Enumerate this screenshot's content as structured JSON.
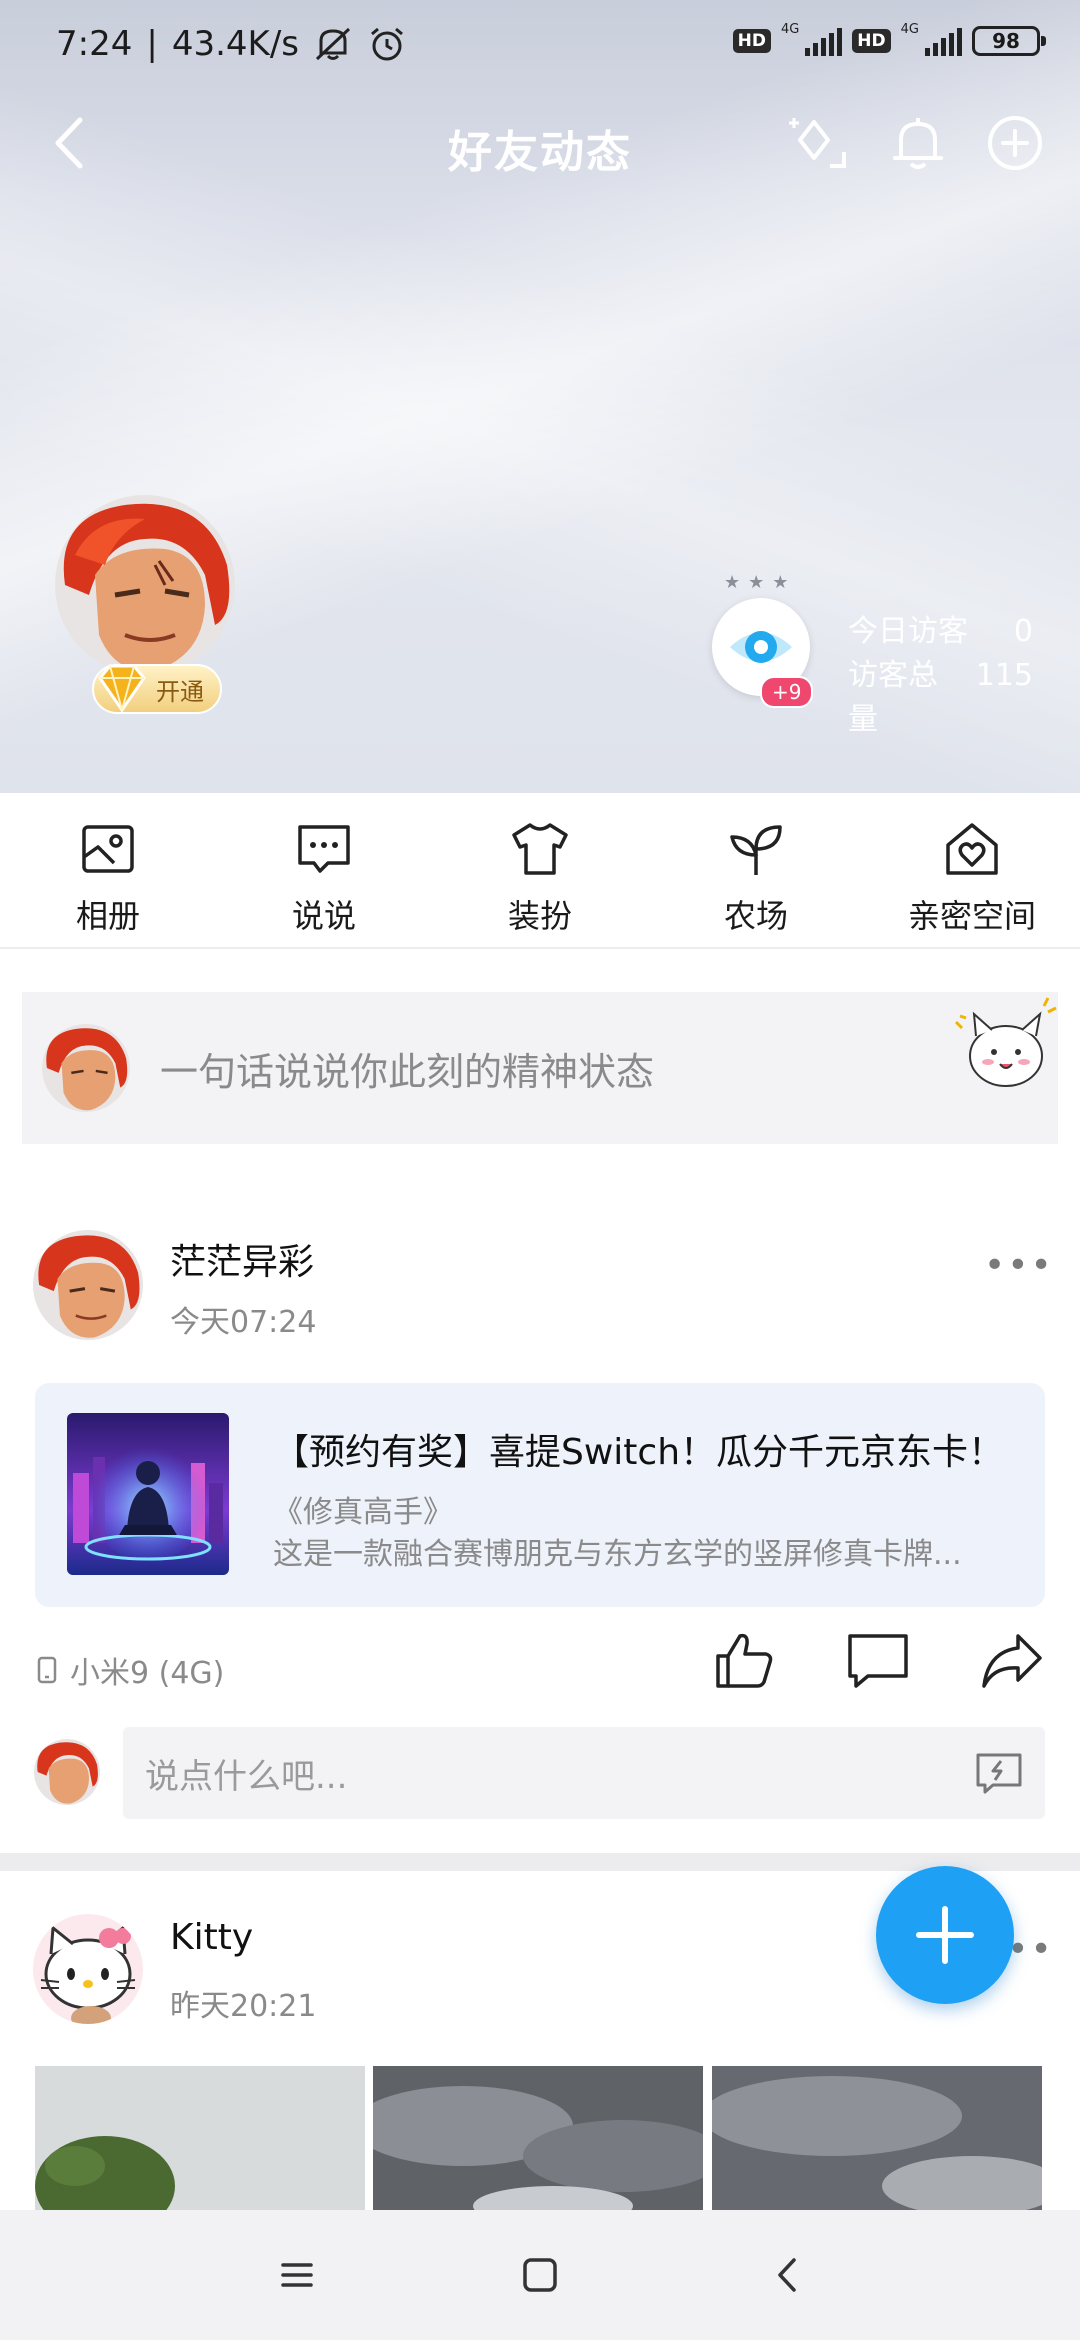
{
  "status_bar": {
    "time": "7:24",
    "separator": "|",
    "net_speed": "43.4K/s",
    "sim1_badge": "HD",
    "sim1_type": "4G",
    "sim2_badge": "HD",
    "sim2_type": "4G",
    "battery": "98",
    "icons": [
      "mute-icon",
      "alarm-icon"
    ]
  },
  "header": {
    "title": "好友动态",
    "icons": [
      "back-icon",
      "decorate-icon",
      "bell-icon",
      "add-circle-icon"
    ]
  },
  "profile": {
    "vip_label": "开通"
  },
  "visitors": {
    "badge": "+9",
    "today_label": "今日访客",
    "today_value": "0",
    "total_label": "访客总量",
    "total_value": "115"
  },
  "quick_menu": [
    {
      "label": "相册",
      "icon": "album-icon"
    },
    {
      "label": "说说",
      "icon": "chat-icon"
    },
    {
      "label": "装扮",
      "icon": "tshirt-icon"
    },
    {
      "label": "农场",
      "icon": "sprout-icon"
    },
    {
      "label": "亲密空间",
      "icon": "heart-house-icon"
    }
  ],
  "compose": {
    "placeholder": "一句话说说你此刻的精神状态"
  },
  "posts": [
    {
      "author": "茫茫异彩",
      "time": "今天07:24",
      "share": {
        "title": "【预约有奖】喜提Switch！瓜分千元京东卡！",
        "game": "《修真高手》",
        "description": "这是一款融合赛博朋克与东方玄学的竖屏修真卡牌..."
      },
      "device": "小米9 (4G)",
      "comment_placeholder": "说点什么吧..."
    },
    {
      "author": "Kitty",
      "time": "昨天20:21"
    }
  ],
  "colors": {
    "accent": "#1ea0f5",
    "badge_red": "#f0476e",
    "card_bg": "#eef2fb"
  }
}
